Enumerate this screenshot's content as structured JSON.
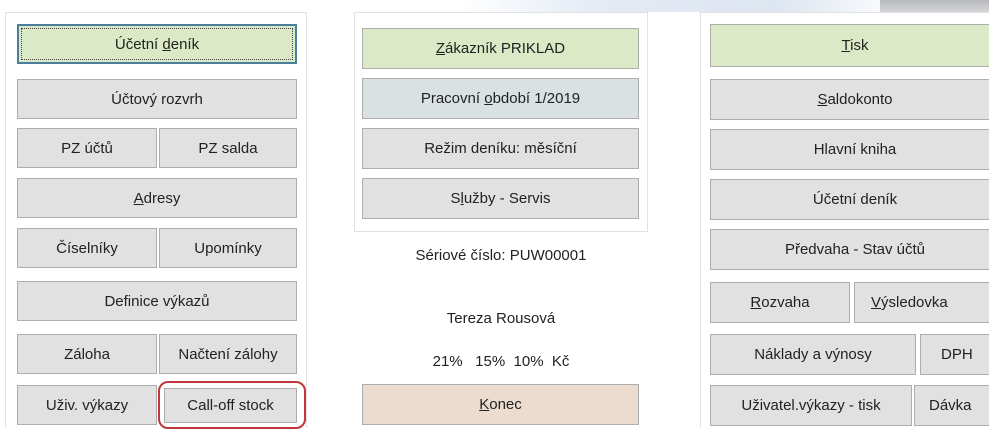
{
  "left": {
    "ucetni_denik": {
      "pre": "Účetní ",
      "ul": "d",
      "post": "eník"
    },
    "uctovy_rozvrh": "Účtový rozvrh",
    "pz_uctu": "PZ účtů",
    "pz_salda": "PZ salda",
    "adresy": {
      "pre": "",
      "ul": "A",
      "post": "dresy"
    },
    "ciselniky": "Číselníky",
    "upominky": "Upomínky",
    "definice_vykazu": "Definice výkazů",
    "zaloha": "Záloha",
    "nacteni_zalohy": "Načtení zálohy",
    "uziv_vykazy": "Uživ. výkazy",
    "call_off_stock": "Call-off stock"
  },
  "middle": {
    "zakaznik": {
      "pre": "",
      "ul": "Z",
      "post": "ákazník  PRIKLAD"
    },
    "pracovni_obdobi": {
      "pre": "Pracovní ",
      "ul": "o",
      "post": "bdobí  1/2019"
    },
    "rezim_deniku": "Režim deníku: měsíční",
    "sluzby": {
      "pre": "S",
      "ul": "l",
      "post": "užby - Servis"
    },
    "seriove_cislo": "Sériové číslo: PUW00001",
    "user_name": "Tereza Rousová",
    "vat_rates": "21%   15%  10%  Kč",
    "konec": {
      "pre": "",
      "ul": "K",
      "post": "onec"
    }
  },
  "right": {
    "tisk": {
      "pre": "",
      "ul": "T",
      "post": "isk"
    },
    "saldokonto": {
      "pre": "",
      "ul": "S",
      "post": "aldokonto"
    },
    "hlavni_kniha": "Hlavní kniha",
    "ucetni_denik": "Účetní deník",
    "predvaha": "Předvaha - Stav účtů",
    "rozvaha": {
      "pre": "",
      "ul": "R",
      "post": "ozvaha"
    },
    "vysledovka": {
      "pre": "",
      "ul": "V",
      "post": "ýsledovka"
    },
    "naklady": "Náklady a výnosy",
    "dph": "DPH",
    "uzivatel_vykazy_tisk": "Uživatel.výkazy - tisk",
    "davka": "Dávka"
  },
  "colors": {
    "button": "#e1e1e1",
    "green": "#dbe9c6",
    "blue": "#d9e1e3",
    "peach": "#ecdccf",
    "highlight": "#c0373c"
  }
}
